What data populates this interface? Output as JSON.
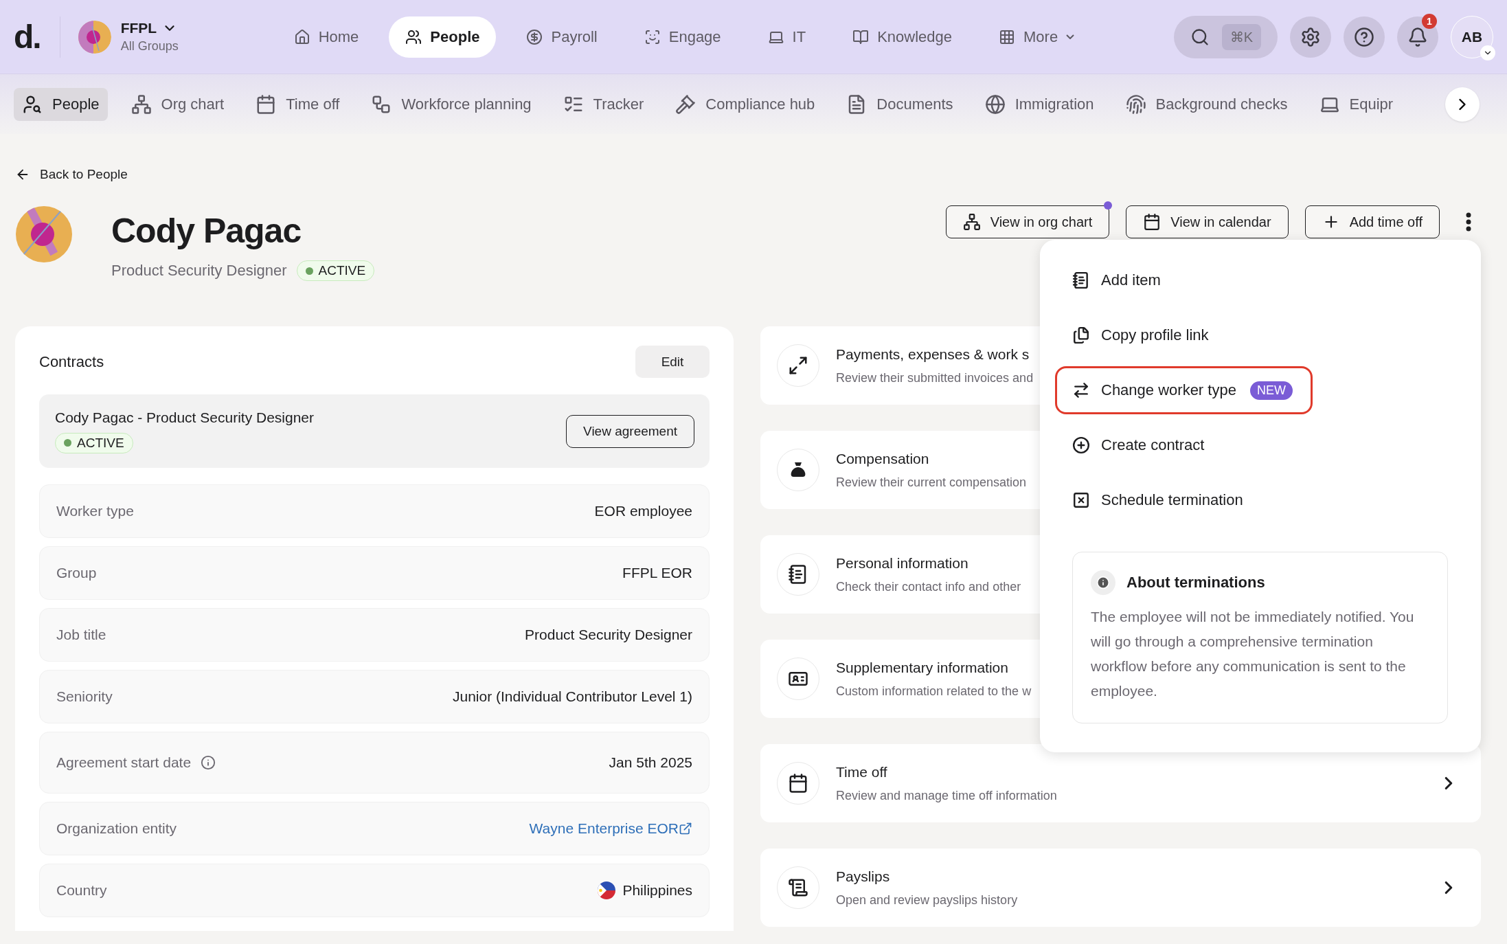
{
  "top_nav": {
    "logo": "d.",
    "org": {
      "name": "FFPL",
      "subtitle": "All Groups"
    },
    "items": [
      {
        "label": "Home",
        "selected": false
      },
      {
        "label": "People",
        "selected": true
      },
      {
        "label": "Payroll",
        "selected": false
      },
      {
        "label": "Engage",
        "selected": false
      },
      {
        "label": "IT",
        "selected": false
      },
      {
        "label": "Knowledge",
        "selected": false
      },
      {
        "label": "More",
        "selected": false
      }
    ],
    "search_shortcut": "⌘K",
    "notification_count": "1",
    "user_initials": "AB"
  },
  "sub_nav": {
    "items": [
      {
        "label": "People",
        "selected": true
      },
      {
        "label": "Org chart",
        "selected": false
      },
      {
        "label": "Time off",
        "selected": false
      },
      {
        "label": "Workforce planning",
        "selected": false
      },
      {
        "label": "Tracker",
        "selected": false
      },
      {
        "label": "Compliance hub",
        "selected": false
      },
      {
        "label": "Documents",
        "selected": false
      },
      {
        "label": "Immigration",
        "selected": false
      },
      {
        "label": "Background checks",
        "selected": false
      },
      {
        "label": "Equipr",
        "selected": false
      }
    ]
  },
  "back_link": "Back to People",
  "profile": {
    "name": "Cody Pagac",
    "title": "Product Security Designer",
    "status": "ACTIVE"
  },
  "actions": [
    {
      "label": "View in org chart",
      "notified": true
    },
    {
      "label": "View in calendar",
      "notified": false
    },
    {
      "label": "Add time off",
      "notified": false
    }
  ],
  "menu": {
    "items": [
      {
        "label": "Add item",
        "highlighted": false
      },
      {
        "label": "Copy profile link",
        "highlighted": false
      },
      {
        "label": "Change worker type",
        "highlighted": true,
        "badge": "NEW"
      },
      {
        "label": "Create contract",
        "highlighted": false
      },
      {
        "label": "Schedule termination",
        "highlighted": false
      }
    ],
    "note": {
      "title": "About terminations",
      "text": "The employee will not be immediately notified. You will go through a comprehensive termination workflow before any communication is sent to the employee."
    }
  },
  "contracts": {
    "title": "Contracts",
    "edit": "Edit",
    "contract": {
      "name": "Cody Pagac - Product Security Designer",
      "status": "ACTIVE",
      "action": "View agreement"
    },
    "fields": [
      {
        "label": "Worker type",
        "value": "EOR employee",
        "kind": "text",
        "info": false
      },
      {
        "label": "Group",
        "value": "FFPL EOR",
        "kind": "text",
        "info": false
      },
      {
        "label": "Job title",
        "value": "Product Security Designer",
        "kind": "text",
        "info": false
      },
      {
        "label": "Seniority",
        "value": "Junior (Individual Contributor Level 1)",
        "kind": "text",
        "info": false
      },
      {
        "label": "Agreement start date",
        "value": "Jan 5th 2025",
        "kind": "text",
        "info": true
      },
      {
        "label": "Organization entity",
        "value": "Wayne Enterprise EOR",
        "kind": "link",
        "info": false
      },
      {
        "label": "Country",
        "value": "Philippines",
        "kind": "country",
        "info": false
      }
    ]
  },
  "sections": [
    {
      "title": "Payments, expenses & work s",
      "subtitle": "Review their submitted invoices and"
    },
    {
      "title": "Compensation",
      "subtitle": "Review their current compensation"
    },
    {
      "title": "Personal information",
      "subtitle": "Check their contact info and other"
    },
    {
      "title": "Supplementary information",
      "subtitle": "Custom information related to the w"
    },
    {
      "title": "Time off",
      "subtitle": "Review and manage time off information",
      "chevron": true
    },
    {
      "title": "Payslips",
      "subtitle": "Open and review payslips history",
      "chevron": true
    }
  ]
}
